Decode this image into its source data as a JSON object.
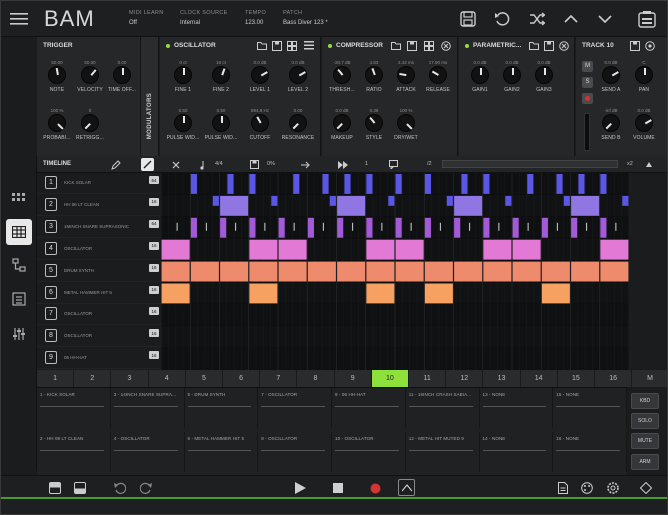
{
  "header": {
    "app_title": "BAM",
    "midi_learn_label": "MIDI LEARN",
    "midi_learn_value": "Off",
    "clock_source_label": "CLOCK SOURCE",
    "clock_source_value": "Internal",
    "tempo_label": "TEMPO",
    "tempo_value": "123.00",
    "patch_label": "PATCH",
    "patch_value": "Bass Diver 123 *"
  },
  "trigger": {
    "title": "TRIGGER",
    "knobs": [
      {
        "label": "NOTE",
        "value": "50.00"
      },
      {
        "label": "VELOCITY",
        "value": "50.00"
      },
      {
        "label": "TIME OFF...",
        "value": "0.00"
      },
      {
        "label": "PROBABI...",
        "value": "100 %"
      },
      {
        "label": "RETRIGG...",
        "value": "0"
      }
    ]
  },
  "modulators_label": "MODULATORS",
  "oscillator": {
    "title": "OSCILLATOR",
    "knobs": [
      {
        "label": "FINE 1",
        "value": "0 ct"
      },
      {
        "label": "FINE 2",
        "value": "16 ct"
      },
      {
        "label": "LEVEL 1",
        "value": "0.0 dB"
      },
      {
        "label": "LEVEL 2",
        "value": "0.0 dB"
      },
      {
        "label": "PULSE WID...",
        "value": "0.50"
      },
      {
        "label": "PULSE WID...",
        "value": "0.50"
      },
      {
        "label": "CUTOFF",
        "value": "894.8 Hz"
      },
      {
        "label": "RESONANCE",
        "value": "0.00"
      }
    ]
  },
  "compressor": {
    "title": "COMPRESSOR",
    "knobs": [
      {
        "label": "THRESH...",
        "value": "-20.7 dB"
      },
      {
        "label": "RATIO",
        "value": "4.53"
      },
      {
        "label": "ATTACK",
        "value": "2.42 ms"
      },
      {
        "label": "RELEASE",
        "value": "17.90 ms"
      },
      {
        "label": "MAKEUP",
        "value": "0.0 dB"
      },
      {
        "label": "STYLE",
        "value": "0.36"
      },
      {
        "label": "DRY/WET",
        "value": "100 %"
      }
    ]
  },
  "parametric": {
    "title": "PARAMETRIC...",
    "knobs": [
      {
        "label": "GAIN1",
        "value": "0.0 dB"
      },
      {
        "label": "GAIN2",
        "value": "0.0 dB"
      },
      {
        "label": "GAIN3",
        "value": "0.0 dB"
      }
    ]
  },
  "track": {
    "title": "TRACK 10",
    "m_label": "M",
    "s_label": "S",
    "knobs": [
      {
        "label": "SEND A",
        "value": "0.0 dB"
      },
      {
        "label": "PAN",
        "value": "C"
      },
      {
        "label": "SEND B",
        "value": "-inf dB"
      },
      {
        "label": "VOLUME",
        "value": "0.0 dB"
      }
    ]
  },
  "timeline": {
    "label": "TIMELINE",
    "time_sig": "4/4",
    "swing": "0%",
    "steps_label": "1",
    "divider": "/2",
    "zoom": "x2",
    "rows": [
      {
        "num": "1",
        "name": "KICK SOLAR",
        "len": "64"
      },
      {
        "num": "2",
        "name": "HH 06 LT CLEAN",
        "len": "16"
      },
      {
        "num": "3",
        "name": "1MINCH SNARE SUPRASONIC",
        "len": "64"
      },
      {
        "num": "4",
        "name": "OSCILLATOR",
        "len": "16"
      },
      {
        "num": "5",
        "name": "DRUM SYNTH",
        "len": "16"
      },
      {
        "num": "6",
        "name": "METAL HAMMER HIT 5",
        "len": "16"
      },
      {
        "num": "7",
        "name": "OSCILLATOR",
        "len": "16"
      },
      {
        "num": "8",
        "name": "OSCILLATOR",
        "len": "16"
      },
      {
        "num": "9",
        "name": "06 HH-HAT",
        "len": "16"
      }
    ]
  },
  "step_numbers": [
    "1",
    "2",
    "3",
    "4",
    "5",
    "6",
    "7",
    "8",
    "9",
    "10",
    "11",
    "12",
    "13",
    "14",
    "15",
    "16",
    "M"
  ],
  "active_step": "10",
  "slots_top": [
    "1 - KICK SOLAR",
    "3 - 14INCH SNARE SUPRA...",
    "5 - DRUM SYNTH",
    "7 - OSCILLATOR",
    "9 - 06 HH-HAT",
    "11 - 16INCH CRASH SABIA...",
    "13 - NONE",
    "15 - NONE"
  ],
  "slots_bottom": [
    "2 - HH 09 LT CLEAN",
    "4 - OSCILLATOR",
    "6 - METAL HAMMER HIT 5",
    "8 - OSCILLATOR",
    "10 - OSCILLATOR",
    "12 - METAL HIT MUTED 9",
    "14 - NONE",
    "16 - NONE"
  ],
  "side_buttons": [
    "KBD",
    "SOLO",
    "MUTE",
    "ARM"
  ],
  "colors": {
    "accent_green": "#8ee03a",
    "blue": "#5a57e6",
    "lavender": "#8f76e3",
    "purple": "#a25ad8",
    "pink": "#e27ad5",
    "salmon": "#ef8b6d",
    "peach": "#f6a061",
    "record_red": "#d63232"
  }
}
